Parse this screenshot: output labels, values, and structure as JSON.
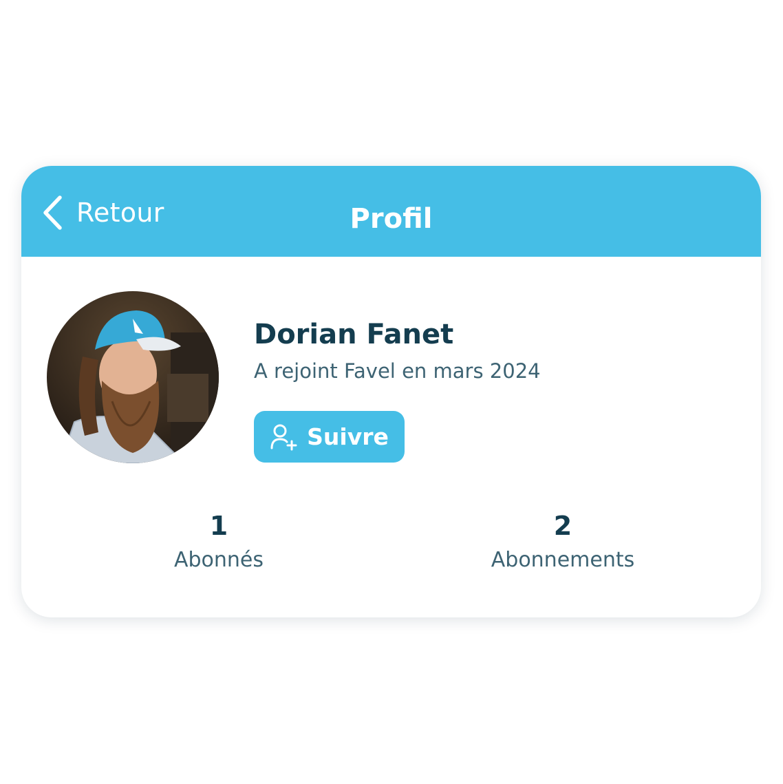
{
  "header": {
    "back_label": "Retour",
    "title": "Profil",
    "background_color": "#45bee6"
  },
  "profile": {
    "name": "Dorian Fanet",
    "joined": "A rejoint Favel en mars 2024",
    "avatar": "profile-photo"
  },
  "actions": {
    "follow_label": "Suivre",
    "follow_icon": "user-plus-icon"
  },
  "stats": [
    {
      "value": "1",
      "label": "Abonnés"
    },
    {
      "value": "2",
      "label": "Abonnements"
    }
  ],
  "colors": {
    "accent": "#45bee6",
    "text_primary": "#143d4f",
    "text_secondary": "#3d6373"
  }
}
